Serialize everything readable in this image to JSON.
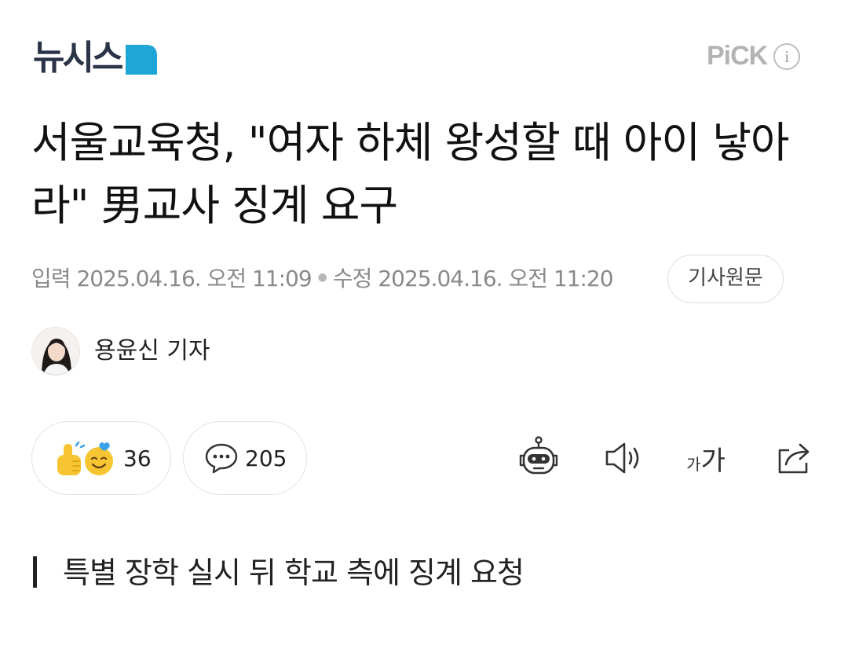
{
  "header": {
    "logo_text": "뉴시스",
    "logo_accent_color": "#1ea7d6",
    "pick_label": "PiCK",
    "info_glyph": "i"
  },
  "article": {
    "headline": "서울교육청, \"여자 하체 왕성할 때 아이 낳아라\" 男교사 징계 요구",
    "published_label": "입력",
    "published": "2025.04.16. 오전 11:09",
    "modified_label": "수정",
    "modified": "2025.04.16. 오전 11:20",
    "original_button": "기사원문",
    "reporter": "용윤신 기자",
    "subheadline": "특별 장학 실시 뒤 학교 측에 징계 요청"
  },
  "actions": {
    "reaction_count": "36",
    "comment_count": "205",
    "font_size_small": "가",
    "font_size_large": "가",
    "icons": [
      "thumbs-up-emoji-icon",
      "smile-emoji-icon",
      "comment-icon",
      "robot-summary-icon",
      "speaker-icon",
      "font-size-icon",
      "share-icon"
    ]
  }
}
